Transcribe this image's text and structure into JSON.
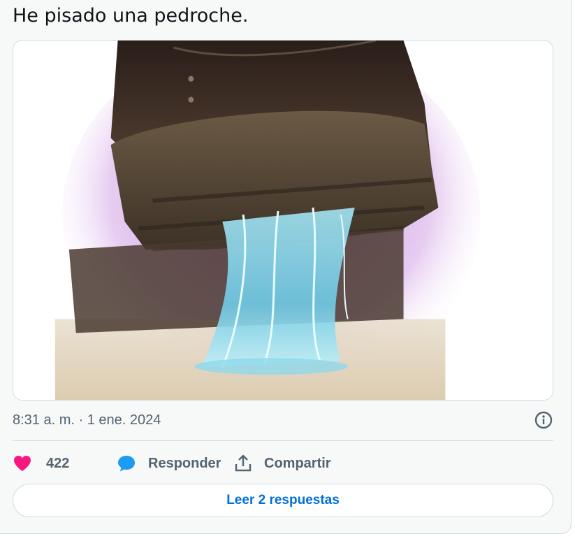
{
  "tweet": {
    "text": "He pisado una pedroche.",
    "timestamp": "8:31 a. m. · 1 ene. 2024",
    "info_icon": "info-circle-icon"
  },
  "media": {
    "subject": "shoe-stepping-on-chewing-gum-image"
  },
  "actions": {
    "like_count": "422",
    "like_icon": "heart-icon",
    "reply_label": "Responder",
    "reply_icon": "speech-bubble-icon",
    "share_label": "Compartir",
    "share_icon": "share-upload-icon"
  },
  "read_replies": {
    "label": "Leer 2 respuestas"
  },
  "colors": {
    "like": "#f91880",
    "reply": "#1d9bf0",
    "link": "#006fd6",
    "muted": "#536471",
    "border": "#cfd9de"
  }
}
